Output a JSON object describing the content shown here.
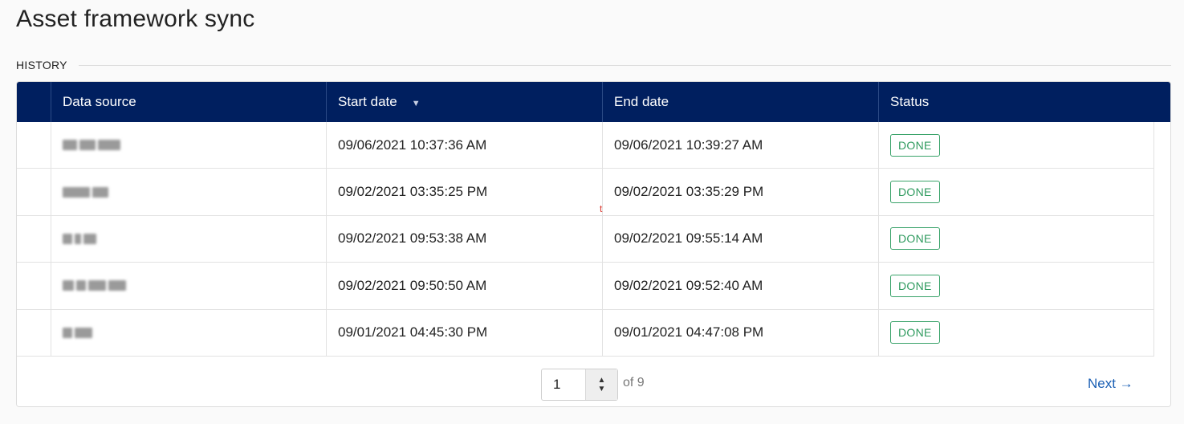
{
  "page": {
    "title": "Asset framework sync"
  },
  "section": {
    "label": "HISTORY"
  },
  "table": {
    "columns": {
      "data_source": "Data source",
      "start_date": "Start date",
      "end_date": "End date",
      "status": "Status"
    },
    "sort_icon": "sort-descending-icon",
    "rows": [
      {
        "start": "09/06/2021 10:37:36 AM",
        "end": "09/06/2021 10:39:27 AM",
        "status": "DONE"
      },
      {
        "start": "09/02/2021 03:35:25 PM",
        "end": "09/02/2021 03:35:29 PM",
        "status": "DONE"
      },
      {
        "start": "09/02/2021 09:53:38 AM",
        "end": "09/02/2021 09:55:14 AM",
        "status": "DONE"
      },
      {
        "start": "09/02/2021 09:50:50 AM",
        "end": "09/02/2021 09:52:40 AM",
        "status": "DONE"
      },
      {
        "start": "09/01/2021 04:45:30 PM",
        "end": "09/01/2021 04:47:08 PM",
        "status": "DONE"
      }
    ]
  },
  "pagination": {
    "current_page": "1",
    "of_total": "of 9",
    "next_label": "Next →"
  },
  "colors": {
    "header_bg": "#001f5f",
    "status_green": "#2e9a5e",
    "link_blue": "#1a5fb4"
  },
  "stray_mark": "t"
}
